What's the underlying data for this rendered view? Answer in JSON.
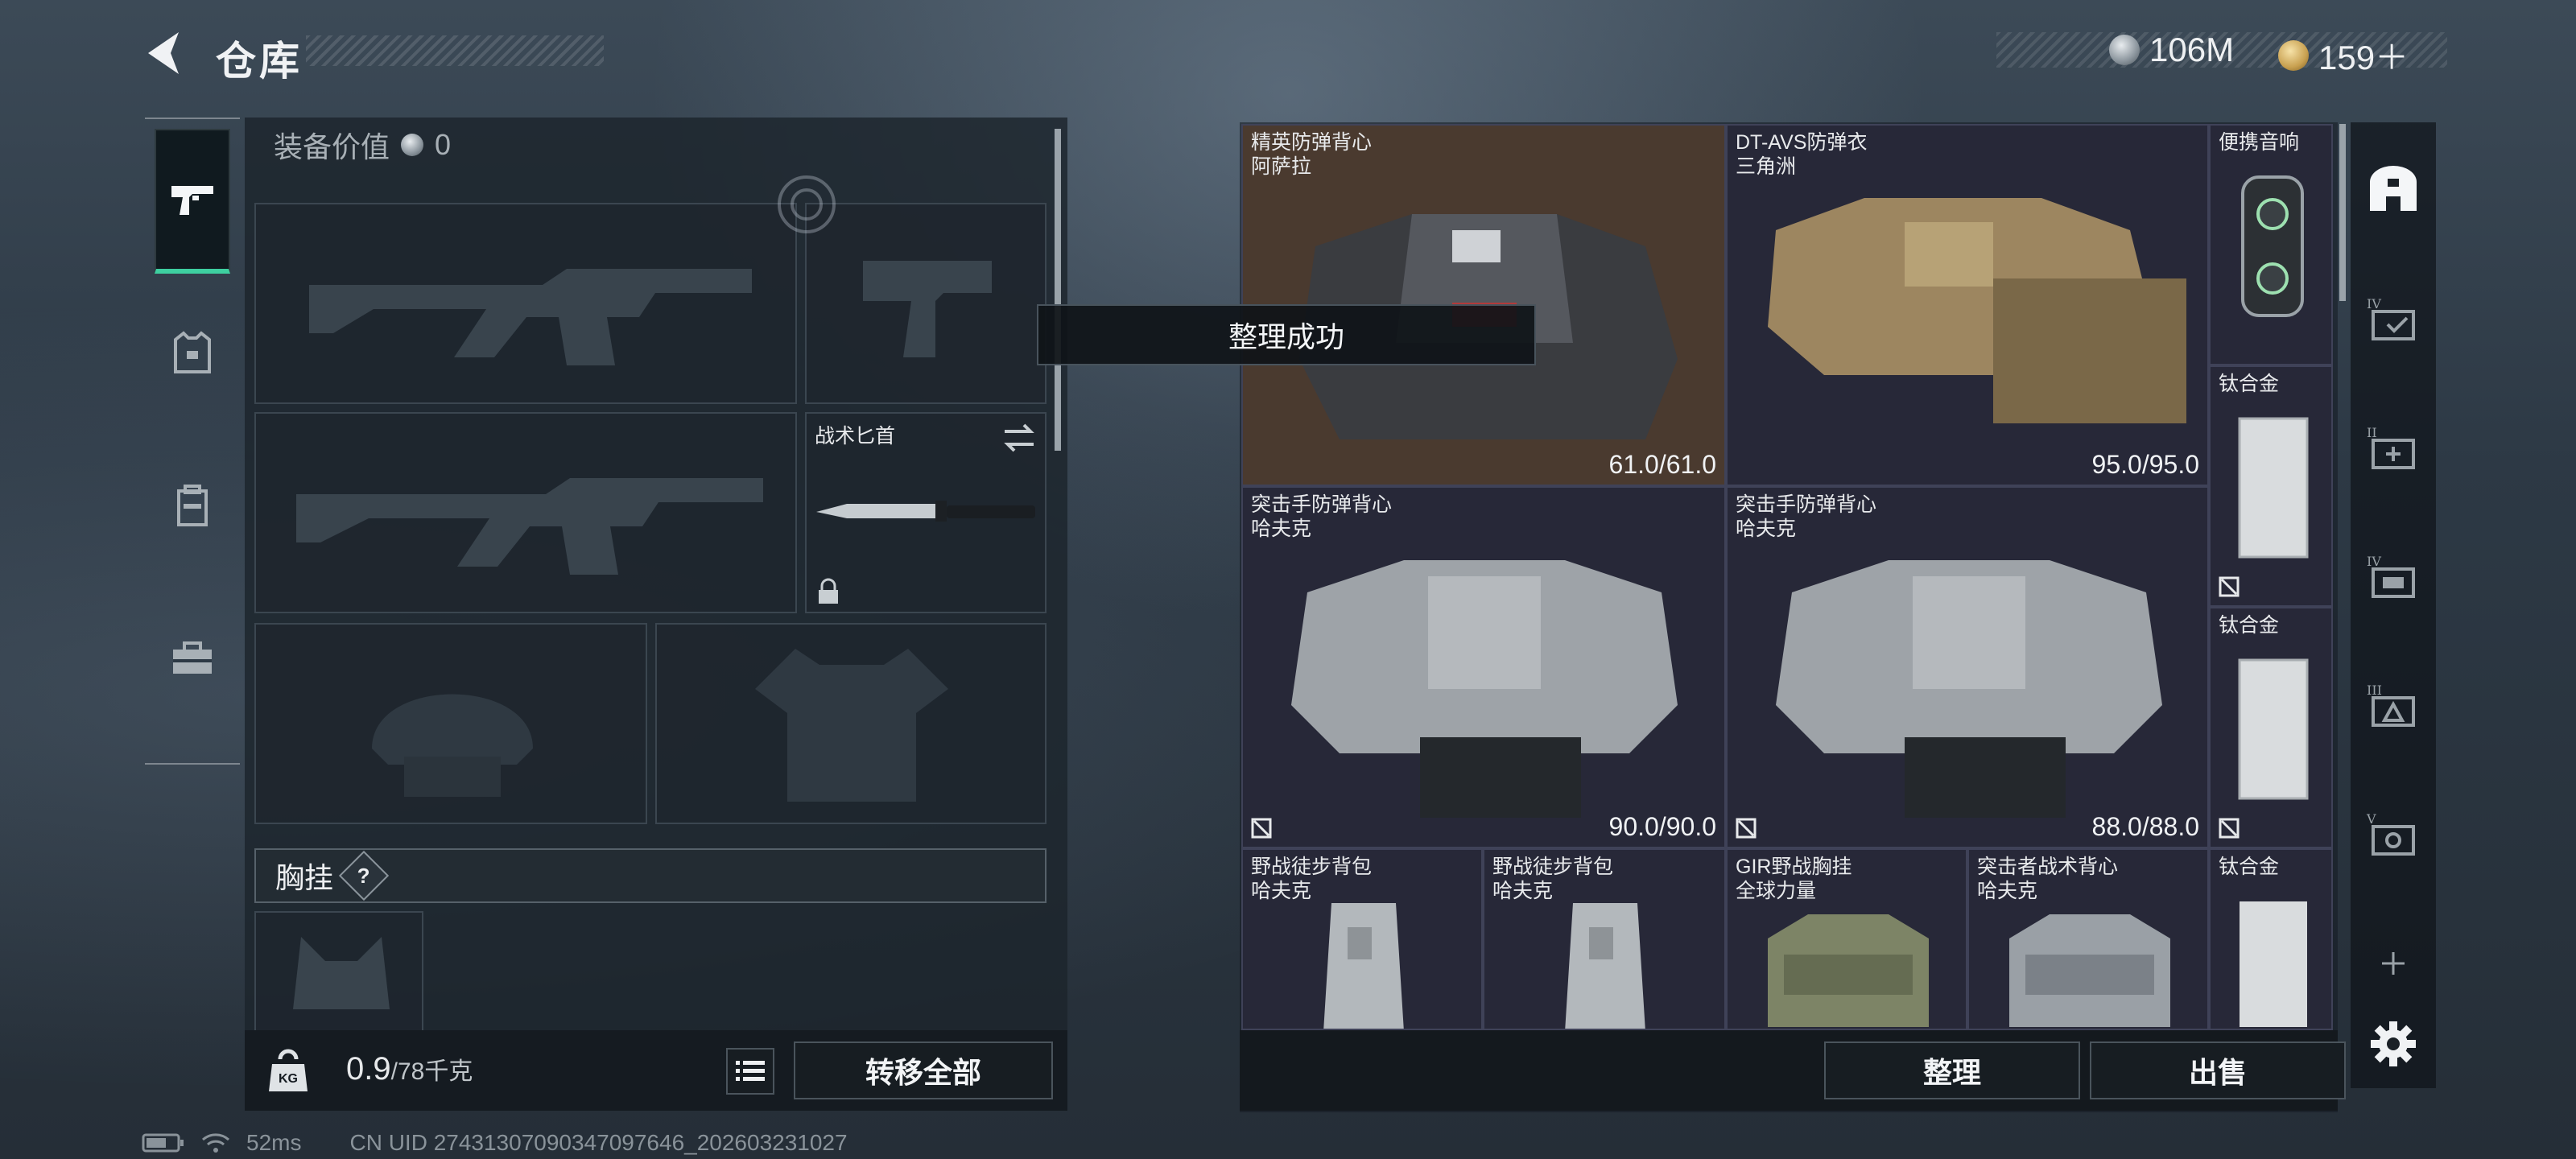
{
  "header": {
    "title": "仓库",
    "currency1": "106M",
    "currency2": "159＋"
  },
  "left_panel": {
    "equip_value_label": "装备价值",
    "equip_value": "0",
    "knife_label": "战术匕首",
    "chest_label": "胸挂",
    "chest_help": "?",
    "weight_value": "0.9",
    "weight_max": "/78千克",
    "kg_icon_text": "KG",
    "transfer_all": "转移全部"
  },
  "toast": "整理成功",
  "inventory": [
    {
      "name": "精英防弹背心\n阿萨拉",
      "durability": "61.0/61.0"
    },
    {
      "name": "DT-AVS防弹衣\n三角洲",
      "durability": "95.0/95.0"
    },
    {
      "name": "便携音响",
      "durability": ""
    },
    {
      "name": "钛合金",
      "durability": ""
    },
    {
      "name": "突击手防弹背心\n哈夫克",
      "durability": "90.0/90.0"
    },
    {
      "name": "突击手防弹背心\n哈夫克",
      "durability": "88.0/88.0"
    },
    {
      "name": "钛合金",
      "durability": ""
    },
    {
      "name": "野战徒步背包\n哈夫克",
      "durability": ""
    },
    {
      "name": "野战徒步背包\n哈夫克",
      "durability": ""
    },
    {
      "name": "GIR野战胸挂\n全球力量",
      "durability": ""
    },
    {
      "name": "突击者战术背心\n哈夫克",
      "durability": ""
    },
    {
      "name": "钛合金",
      "durability": ""
    }
  ],
  "right_buttons": {
    "sort": "整理",
    "sell": "出售"
  },
  "status_bar": {
    "ping": "52ms",
    "uid": "CN UID 27431307090347097646_202603231027"
  }
}
